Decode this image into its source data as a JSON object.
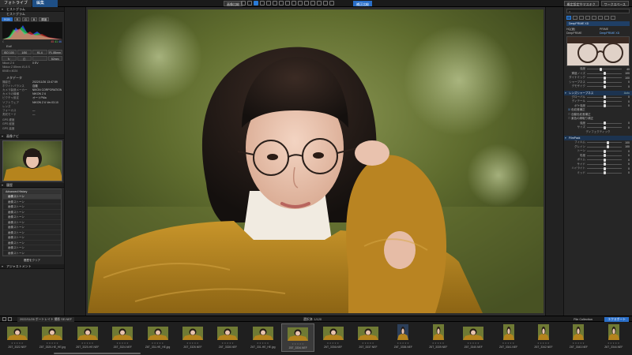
{
  "topbar": {
    "tab_library": "フォトライブラリ",
    "tab_edit": "編集",
    "btn_view": "画像比較",
    "btn_view2": "補正比較",
    "right_1": "概定設定やマスキク",
    "right_2": "ワークスペース"
  },
  "left": {
    "histogram_title": "ヒストグラム",
    "histogram_sub": "ヒストグラム",
    "hist_tabs": [
      "RGB",
      "R",
      "G",
      "B",
      "輝度"
    ],
    "hist_vals": {
      "r": "45",
      "g": "41",
      "b": "46"
    },
    "exif_title": "Exif",
    "exif_buttons": [
      "ISO 100",
      "1/50",
      "f/1.4",
      "FL 85mm"
    ],
    "exif_buttons2": [
      "↻",
      "◫",
      "",
      "52mm"
    ],
    "meta_rows": [
      {
        "k": "Nikon Z 6",
        "v": "0 EV"
      },
      {
        "k": "Nikkor Z 85mm f/1.8 S",
        "v": ""
      },
      {
        "k": "6048 x 4024",
        "v": ""
      }
    ],
    "meta2_title": "メタデータ",
    "meta2_rows": [
      {
        "k": "撮影日",
        "v": "2022/11/26 13:47:59"
      },
      {
        "k": "ホワイトバランス",
        "v": "自動"
      },
      {
        "k": "カメラ製造メーカー",
        "v": "NIKON CORPORATION"
      },
      {
        "k": "カメラの機種",
        "v": "NIKON Z 6"
      },
      {
        "k": "ピクチャ設定",
        "v": "オートPMa"
      },
      {
        "k": "ソフトウェア",
        "v": "NIKON Z 6 Ver.03.10"
      },
      {
        "k": "レンズ",
        "v": ""
      },
      {
        "k": "フォーカス",
        "v": "—"
      },
      {
        "k": "測光モード",
        "v": "—"
      }
    ],
    "gps_rows": [
      {
        "k": "GPS 緯度",
        "v": ""
      },
      {
        "k": "GPS 経度",
        "v": ""
      },
      {
        "k": "GPS 高度",
        "v": ""
      }
    ],
    "navigator_title": "画像ナビ",
    "history_title": "履歴",
    "history_items": [
      "Advanced History",
      "画像ストーン",
      "画像ストーン",
      "画像ストーン",
      "画像ストーン",
      "画像ストーン",
      "画像ストーン",
      "画像ストーン",
      "画像ストーン",
      "画像ストーン",
      "画像ストーン",
      "画像ストーン",
      "画像ストーン"
    ],
    "history_clear": "履歴をクリア",
    "last_section": "アジャストメント"
  },
  "right": {
    "preset_label": "DeepPRIME XD",
    "radio": [
      {
        "label": "HQ(速)",
        "on": false
      },
      {
        "label": "PRIME",
        "on": false
      },
      {
        "label": "DeepPRIME",
        "on": false
      },
      {
        "label": "DeepPRIME XD",
        "on": true
      }
    ],
    "sliders_1": [
      {
        "label": "強度",
        "value": "40",
        "pos": 0.4
      },
      {
        "label": "輝度ノイズ",
        "value": "100",
        "pos": 0.5
      },
      {
        "label": "ダイナミック",
        "value": "100",
        "pos": 0.5
      },
      {
        "label": "シャープネス",
        "value": "0",
        "pos": 0.5
      },
      {
        "label": "デモザイク",
        "value": "0",
        "pos": 0.5
      }
    ],
    "section_2": "レンズシャープネス",
    "section_2_sub": "Auto",
    "sliders_2": [
      {
        "label": "グローバル",
        "value": "0",
        "pos": 0.5
      },
      {
        "label": "ディテール",
        "value": "0",
        "pos": 0.5
      },
      {
        "label": "ボケ強度",
        "value": "0",
        "pos": 0.5
      }
    ],
    "checks": [
      {
        "label": "色収差補正",
        "checked": true
      },
      {
        "label": "自動色収差補正",
        "checked": false
      },
      {
        "label": "紫色の縁取り補正",
        "checked": false
      }
    ],
    "sliders_3": [
      {
        "label": "強度",
        "value": "0",
        "pos": 0.5
      },
      {
        "label": "サイズ",
        "value": "0",
        "pos": 0.5
      }
    ],
    "center_label": "ディフェクティック",
    "section_3": "FilmPack",
    "sliders_4": [
      {
        "label": "フィルム",
        "value": "100",
        "pos": 0.6
      },
      {
        "label": "グレイン",
        "value": "100",
        "pos": 0.6
      },
      {
        "label": "トーン",
        "value": "0",
        "pos": 0.5
      },
      {
        "label": "彩度",
        "value": "0",
        "pos": 0.5
      },
      {
        "label": "ボトム",
        "value": "0",
        "pos": 0.5
      },
      {
        "label": "サイド",
        "value": "0",
        "pos": 0.5
      },
      {
        "label": "ハイライト",
        "value": "0",
        "pos": 0.5
      },
      {
        "label": "ミッド",
        "value": "0",
        "pos": 0.5
      }
    ]
  },
  "film": {
    "path": "2022/11/26 ポートレイト 撮影 SE.NEF",
    "count": "選択済: 1/120",
    "collection": "File Collection",
    "export": "エクスポート",
    "frames": [
      {
        "name": "Z6T_3322.NEF",
        "tone": "y",
        "w": 26,
        "h": 17
      },
      {
        "name": "Z6T_3320-HE_HE.jpg",
        "tone": "y",
        "w": 26,
        "h": 17
      },
      {
        "name": "Z6T_3320-HE.NEF",
        "tone": "y",
        "w": 26,
        "h": 17
      },
      {
        "name": "Z6T_3324.NEF",
        "tone": "y",
        "w": 26,
        "h": 17
      },
      {
        "name": "Z6T_331-HE_HE.jpg",
        "tone": "y",
        "w": 26,
        "h": 17
      },
      {
        "name": "Z6T_3326.NEF",
        "tone": "y",
        "w": 26,
        "h": 17
      },
      {
        "name": "Z6T_3328.NEF",
        "tone": "y",
        "w": 26,
        "h": 17
      },
      {
        "name": "Z6T_331-HE_HE.jpg",
        "tone": "y",
        "w": 26,
        "h": 17
      },
      {
        "name": "Z6T_3334.NEF",
        "tone": "y",
        "w": 26,
        "h": 17
      },
      {
        "name": "Z6T_3336.NEF",
        "tone": "y",
        "w": 26,
        "h": 17
      },
      {
        "name": "Z6T_3337.NEF",
        "tone": "y",
        "w": 26,
        "h": 17
      },
      {
        "name": "Z6T_3338.NEF",
        "tone": "b",
        "w": 14,
        "h": 20
      },
      {
        "name": "Z6T_3339.NEF",
        "tone": "y",
        "w": 14,
        "h": 20
      },
      {
        "name": "Z6T_3340.NEF",
        "tone": "y",
        "w": 26,
        "h": 17
      },
      {
        "name": "Z6T_3341.NEF",
        "tone": "y",
        "w": 14,
        "h": 20
      },
      {
        "name": "Z6T_3342.NEF",
        "tone": "y",
        "w": 14,
        "h": 20
      },
      {
        "name": "Z6T_3343.NEF",
        "tone": "y",
        "w": 14,
        "h": 20
      },
      {
        "name": "Z6T_3344.NEF",
        "tone": "y",
        "w": 14,
        "h": 20
      }
    ],
    "selected_index": 8
  },
  "colors": {
    "accent": "#2a6fc9",
    "sweater": "#b8861f",
    "background_green": "#5d6b2a"
  }
}
